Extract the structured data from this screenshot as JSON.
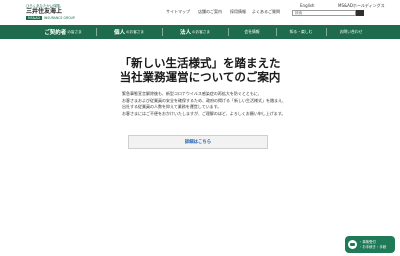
{
  "header": {
    "logo": {
      "tagline": "ひろくあたたかい保険。",
      "company": "三井住友海上",
      "badge": "MS&AD",
      "group": "INSURANCE GROUP"
    },
    "utility_links": [
      "サイトマップ",
      "店舗のご案内",
      "採用情報",
      "よくあるご質問"
    ],
    "language": "English",
    "holdings": "MS&ADホールディングス",
    "search_placeholder": "検索"
  },
  "nav": {
    "items": [
      {
        "main": "ご契約者",
        "suffix": "の皆さま"
      },
      {
        "main": "個人",
        "suffix": "のお客さま"
      },
      {
        "main": "法人",
        "suffix": "のお客さま"
      },
      {
        "main": "会社情報",
        "suffix": ""
      },
      {
        "main": "知る・楽しむ",
        "suffix": ""
      },
      {
        "main": "お問い合わせ",
        "suffix": ""
      }
    ]
  },
  "main": {
    "title_line1": "「新しい生活様式」を踏まえた",
    "title_line2": "当社業務運営についてのご案内",
    "paragraphs": [
      "緊急事態宣言解除後も、新型コロナウイルス感染症の再拡大を防ぐとともに、",
      "お客さまおよび従業員の安全を確保するため、政府の掲げる「新しい生活様式」を踏まえ、",
      "出社する従業員の人数を抑えて業務を運営しています。",
      "お客さまにはご不便をおかけいたしますが、ご理解のほど、よろしくお願い申し上げます。"
    ],
    "detail_button": "詳細はこちら"
  },
  "chat": {
    "line1": "・事故受付",
    "line2": "・お手続き・手続"
  }
}
